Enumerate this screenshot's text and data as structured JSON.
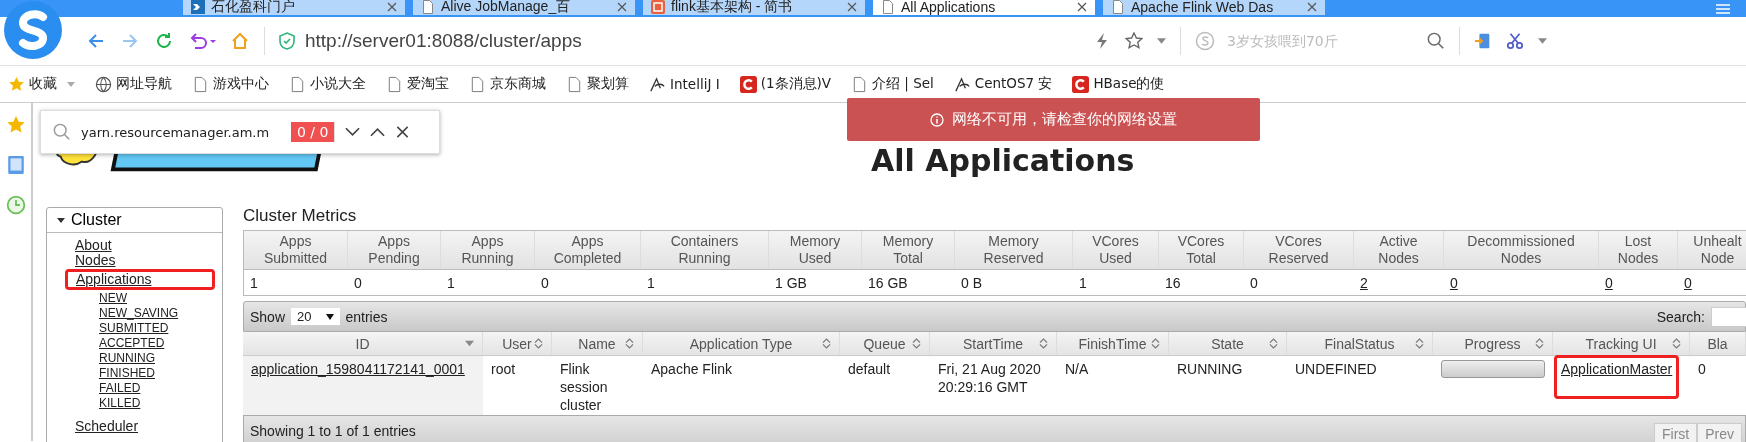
{
  "browser": {
    "tabs": [
      {
        "title": "石化盈科门户",
        "kind": "brand",
        "selected": false
      },
      {
        "title": "Alive JobManage_百",
        "kind": "page",
        "selected": false
      },
      {
        "title": "flink基本架构 - 简书",
        "kind": "jian",
        "selected": false
      },
      {
        "title": "All Applications",
        "kind": "page",
        "selected": true
      },
      {
        "title": "Apache Flink Web Das",
        "kind": "page",
        "selected": false
      }
    ],
    "url": "http://server01:8088/cluster/apps",
    "search": {
      "placeholder": "3岁女孩喂到70斤"
    },
    "bookmarks": [
      {
        "label": "收藏",
        "kind": "star"
      },
      {
        "label": "网址导航",
        "kind": "globe"
      },
      {
        "label": "游戏中心",
        "kind": "page"
      },
      {
        "label": "小说大全",
        "kind": "page"
      },
      {
        "label": "爱淘宝",
        "kind": "page"
      },
      {
        "label": "京东商城",
        "kind": "page"
      },
      {
        "label": "聚划算",
        "kind": "page"
      },
      {
        "label": "IntelliJ I",
        "kind": "swirl"
      },
      {
        "label": "(1条消息)V",
        "kind": "red"
      },
      {
        "label": "介绍 | Sel",
        "kind": "page"
      },
      {
        "label": "CentOS7 安",
        "kind": "swirl"
      },
      {
        "label": "HBase的使",
        "kind": "red"
      }
    ]
  },
  "find_bar": {
    "value": "yarn.resourcemanager.am.m",
    "count": "0 / 0"
  },
  "toast": {
    "message": "网络不可用，请检查你的网络设置"
  },
  "page_title": "All Applications",
  "nav": {
    "title": "Cluster",
    "expanded": true,
    "items": [
      {
        "label": "About",
        "highlighted": false
      },
      {
        "label": "Nodes",
        "highlighted": false
      },
      {
        "label": "Applications",
        "highlighted": true,
        "children": [
          {
            "label": "NEW"
          },
          {
            "label": "NEW_SAVING"
          },
          {
            "label": "SUBMITTED"
          },
          {
            "label": "ACCEPTED"
          },
          {
            "label": "RUNNING"
          },
          {
            "label": "FINISHED"
          },
          {
            "label": "FAILED"
          },
          {
            "label": "KILLED"
          }
        ]
      },
      {
        "label": "Scheduler",
        "highlighted": false
      }
    ]
  },
  "metrics": {
    "title": "Cluster Metrics",
    "columns": [
      {
        "label": "Apps\nSubmitted",
        "value": "1",
        "link": false
      },
      {
        "label": "Apps\nPending",
        "value": "0",
        "link": false
      },
      {
        "label": "Apps\nRunning",
        "value": "1",
        "link": false
      },
      {
        "label": "Apps\nCompleted",
        "value": "0",
        "link": false
      },
      {
        "label": "Containers\nRunning",
        "value": "1",
        "link": false
      },
      {
        "label": "Memory\nUsed",
        "value": "1 GB",
        "link": false
      },
      {
        "label": "Memory\nTotal",
        "value": "16 GB",
        "link": false
      },
      {
        "label": "Memory\nReserved",
        "value": "0 B",
        "link": false
      },
      {
        "label": "VCores\nUsed",
        "value": "1",
        "link": false
      },
      {
        "label": "VCores\nTotal",
        "value": "16",
        "link": false
      },
      {
        "label": "VCores\nReserved",
        "value": "0",
        "link": false
      },
      {
        "label": "Active\nNodes",
        "value": "2",
        "link": true
      },
      {
        "label": "Decommissioned\nNodes",
        "value": "0",
        "link": true
      },
      {
        "label": "Lost\nNodes",
        "value": "0",
        "link": true
      },
      {
        "label": "Unhealt\nNode",
        "value": "0",
        "link": true
      }
    ]
  },
  "apps": {
    "show_label": "Show",
    "page_size": "20",
    "entries_label": "entries",
    "search_label": "Search:",
    "columns": [
      {
        "label": "ID",
        "sorted": true
      },
      {
        "label": "User",
        "sorted": false
      },
      {
        "label": "Name",
        "sorted": false
      },
      {
        "label": "Application Type",
        "sorted": false
      },
      {
        "label": "Queue",
        "sorted": false
      },
      {
        "label": "StartTime",
        "sorted": false
      },
      {
        "label": "FinishTime",
        "sorted": false
      },
      {
        "label": "State",
        "sorted": false
      },
      {
        "label": "FinalStatus",
        "sorted": false
      },
      {
        "label": "Progress",
        "sorted": false
      },
      {
        "label": "Tracking UI",
        "sorted": false
      },
      {
        "label": "Bla"
      }
    ],
    "rows": [
      {
        "id": "application_1598041172141_0001",
        "user": "root",
        "name": "Flink\nsession\ncluster",
        "type": "Apache Flink",
        "queue": "default",
        "start": "Fri, 21 Aug 2020\n20:29:16 GMT",
        "finish": "N/A",
        "state": "RUNNING",
        "final_status": "UNDEFINED",
        "progress": {
          "level": 0
        },
        "tracking": "ApplicationMaster",
        "tracking_highlighted": true,
        "blacklisted": "0"
      }
    ],
    "footer": "Showing 1 to 1 of 1 entries",
    "pager": [
      "First",
      "Prev"
    ]
  }
}
